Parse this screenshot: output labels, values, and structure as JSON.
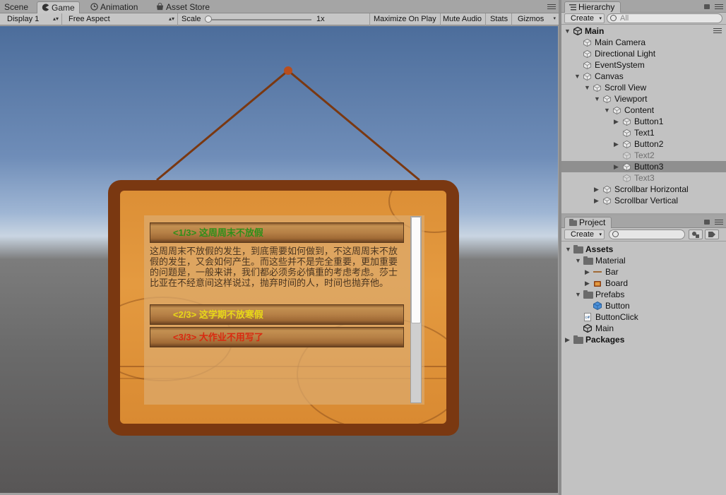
{
  "game_panel": {
    "tabs": [
      {
        "label": "Scene",
        "icon": "scene-icon"
      },
      {
        "label": "Game",
        "icon": "pacman-icon"
      },
      {
        "label": "Animation",
        "icon": "clock-icon"
      },
      {
        "label": "Asset Store",
        "icon": "store-icon"
      }
    ],
    "toolbar": {
      "display": "Display 1",
      "aspect": "Free Aspect",
      "scale_label": "Scale",
      "scale_value": "1x",
      "scale_level": 0.0,
      "maximize": "Maximize On Play",
      "mute": "Mute Audio",
      "stats": "Stats",
      "gizmos": "Gizmos"
    },
    "scroll_view": {
      "buttons": [
        {
          "label": "<1/3>  这周周末不放假",
          "color": "#2f8f1a"
        },
        {
          "label": "<2/3>  这学期不放寒假",
          "color": "#e8d818"
        },
        {
          "label": "<3/3>  大作业不用写了",
          "color": "#d82a10"
        }
      ],
      "body_text": "这周周末不放假的发生，到底需要如何做到，不这周周末不放假的发生，又会如何产生。而这些并不是完全重要，更加重要的问题是，一般来讲，我们都必须务必慎重的考虑考虑。莎士比亚在不经意间这样说过，抛弃时间的人，时间也抛弃他。",
      "scroll_position": 0.0
    }
  },
  "hierarchy": {
    "tab_label": "Hierarchy",
    "create_label": "Create",
    "search_placeholder": "All",
    "scene_name": "Main",
    "items": [
      {
        "label": "Main Camera",
        "depth": 1,
        "expand": "none",
        "state": "active"
      },
      {
        "label": "Directional Light",
        "depth": 1,
        "expand": "none",
        "state": "active"
      },
      {
        "label": "EventSystem",
        "depth": 1,
        "expand": "none",
        "state": "active"
      },
      {
        "label": "Canvas",
        "depth": 1,
        "expand": "open",
        "state": "active"
      },
      {
        "label": "Scroll View",
        "depth": 2,
        "expand": "open",
        "state": "active"
      },
      {
        "label": "Viewport",
        "depth": 3,
        "expand": "open",
        "state": "active"
      },
      {
        "label": "Content",
        "depth": 4,
        "expand": "open",
        "state": "active"
      },
      {
        "label": "Button1",
        "depth": 5,
        "expand": "closed",
        "state": "active"
      },
      {
        "label": "Text1",
        "depth": 5,
        "expand": "none",
        "state": "active"
      },
      {
        "label": "Button2",
        "depth": 5,
        "expand": "closed",
        "state": "active"
      },
      {
        "label": "Text2",
        "depth": 5,
        "expand": "none",
        "state": "inactive"
      },
      {
        "label": "Button3",
        "depth": 5,
        "expand": "closed",
        "state": "selected"
      },
      {
        "label": "Text3",
        "depth": 5,
        "expand": "none",
        "state": "inactive"
      },
      {
        "label": "Scrollbar Horizontal",
        "depth": 3,
        "expand": "closed",
        "state": "active"
      },
      {
        "label": "Scrollbar Vertical",
        "depth": 3,
        "expand": "closed",
        "state": "active"
      }
    ]
  },
  "project": {
    "tab_label": "Project",
    "create_label": "Create",
    "items": [
      {
        "label": "Assets",
        "depth": 0,
        "expand": "open",
        "icon": "folder-icon",
        "bold": true
      },
      {
        "label": "Material",
        "depth": 1,
        "expand": "open",
        "icon": "folder-icon",
        "bold": false
      },
      {
        "label": "Bar",
        "depth": 2,
        "expand": "closed",
        "icon": "bar-sprite-icon",
        "bold": false
      },
      {
        "label": "Board",
        "depth": 2,
        "expand": "closed",
        "icon": "board-sprite-icon",
        "bold": false
      },
      {
        "label": "Prefabs",
        "depth": 1,
        "expand": "open",
        "icon": "folder-icon",
        "bold": false
      },
      {
        "label": "Button",
        "depth": 2,
        "expand": "none",
        "icon": "prefab-icon",
        "bold": false
      },
      {
        "label": "ButtonClick",
        "depth": 1,
        "expand": "none",
        "icon": "csharp-script-icon",
        "bold": false
      },
      {
        "label": "Main",
        "depth": 1,
        "expand": "none",
        "icon": "unity-scene-icon",
        "bold": false
      },
      {
        "label": "Packages",
        "depth": 0,
        "expand": "closed",
        "icon": "folder-icon",
        "bold": true
      }
    ]
  }
}
